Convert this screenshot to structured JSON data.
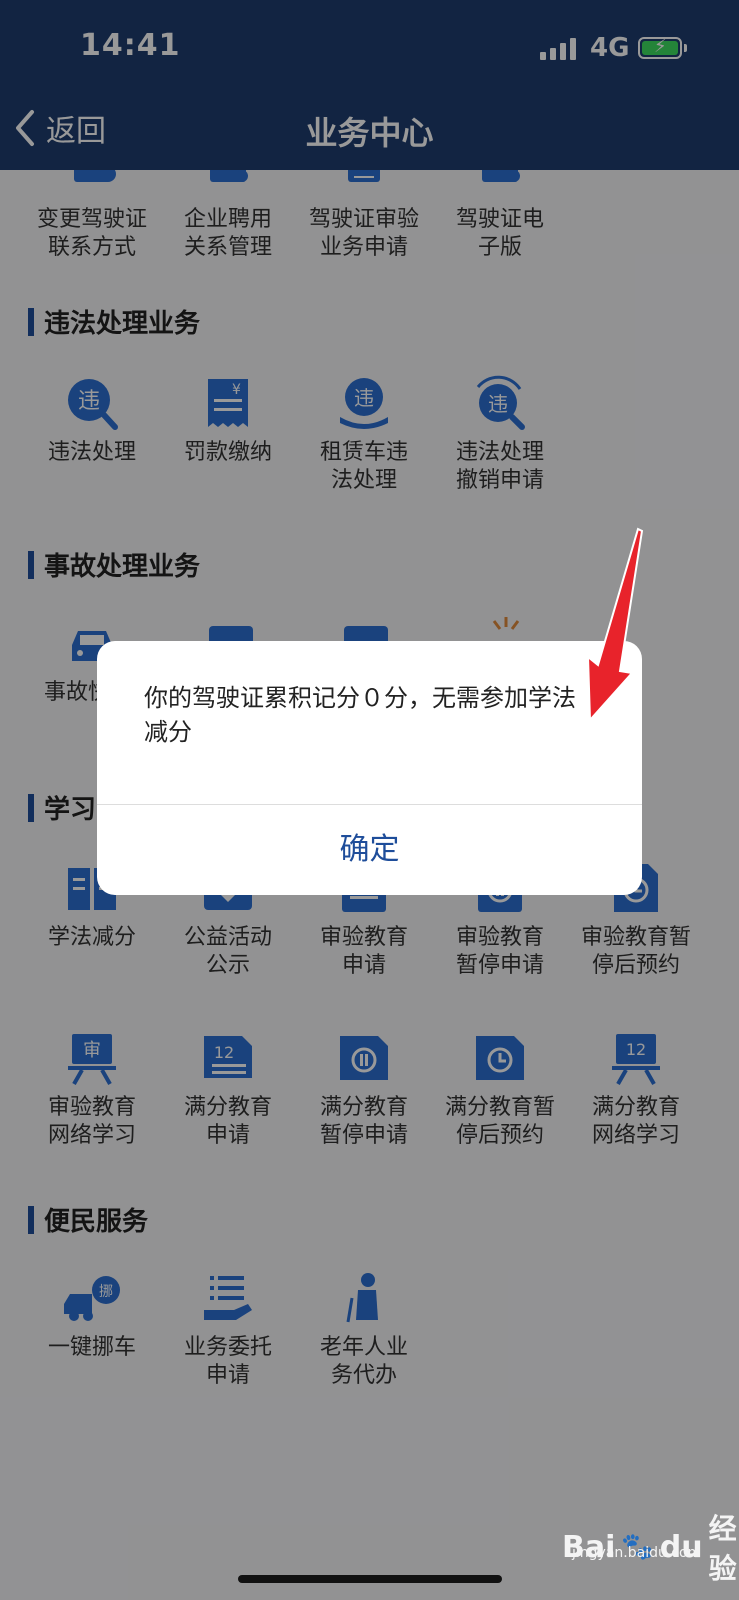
{
  "status_bar": {
    "time": "14:41",
    "network": "4G"
  },
  "nav": {
    "back_label": "返回",
    "title": "业务中心"
  },
  "top_row": [
    "变更驾驶证\n联系方式",
    "企业聘用\n关系管理",
    "驾驶证审验\n业务申请",
    "驾驶证电\n子版"
  ],
  "sections": [
    {
      "title": "违法处理业务",
      "items": [
        "违法处理",
        "罚款缴纳",
        "租赁车违\n法处理",
        "违法处理\n撤销申请"
      ]
    },
    {
      "title": "事故处理业务",
      "items": [
        "事故快"
      ]
    },
    {
      "title": "学习",
      "items": [
        "学法减分",
        "公益活动\n公示",
        "审验教育\n申请",
        "审验教育\n暂停申请",
        "审验教育暂\n停后预约",
        "审验教育\n网络学习",
        "满分教育\n申请",
        "满分教育\n暂停申请",
        "满分教育暂\n停后预约",
        "满分教育\n网络学习"
      ]
    },
    {
      "title": "便民服务",
      "items": [
        "一键挪车",
        "业务委托\n申请",
        "老年人业\n务代办"
      ]
    }
  ],
  "icon_texts": {
    "violation": "违",
    "cal_12": "12",
    "shen": "审",
    "move": "挪",
    "yen": "¥"
  },
  "dialog": {
    "message": "你的驾驶证累积记分０分，无需参加学法减分",
    "confirm_label": "确定"
  },
  "watermark": {
    "brand": "Bai",
    "brand2": "du",
    "suffix": "经验",
    "url": "jingyan.baidu.com"
  },
  "colors": {
    "header": "#1e3d6f",
    "icon_blue": "#2c6fd1",
    "accent": "#1e4d9a"
  }
}
